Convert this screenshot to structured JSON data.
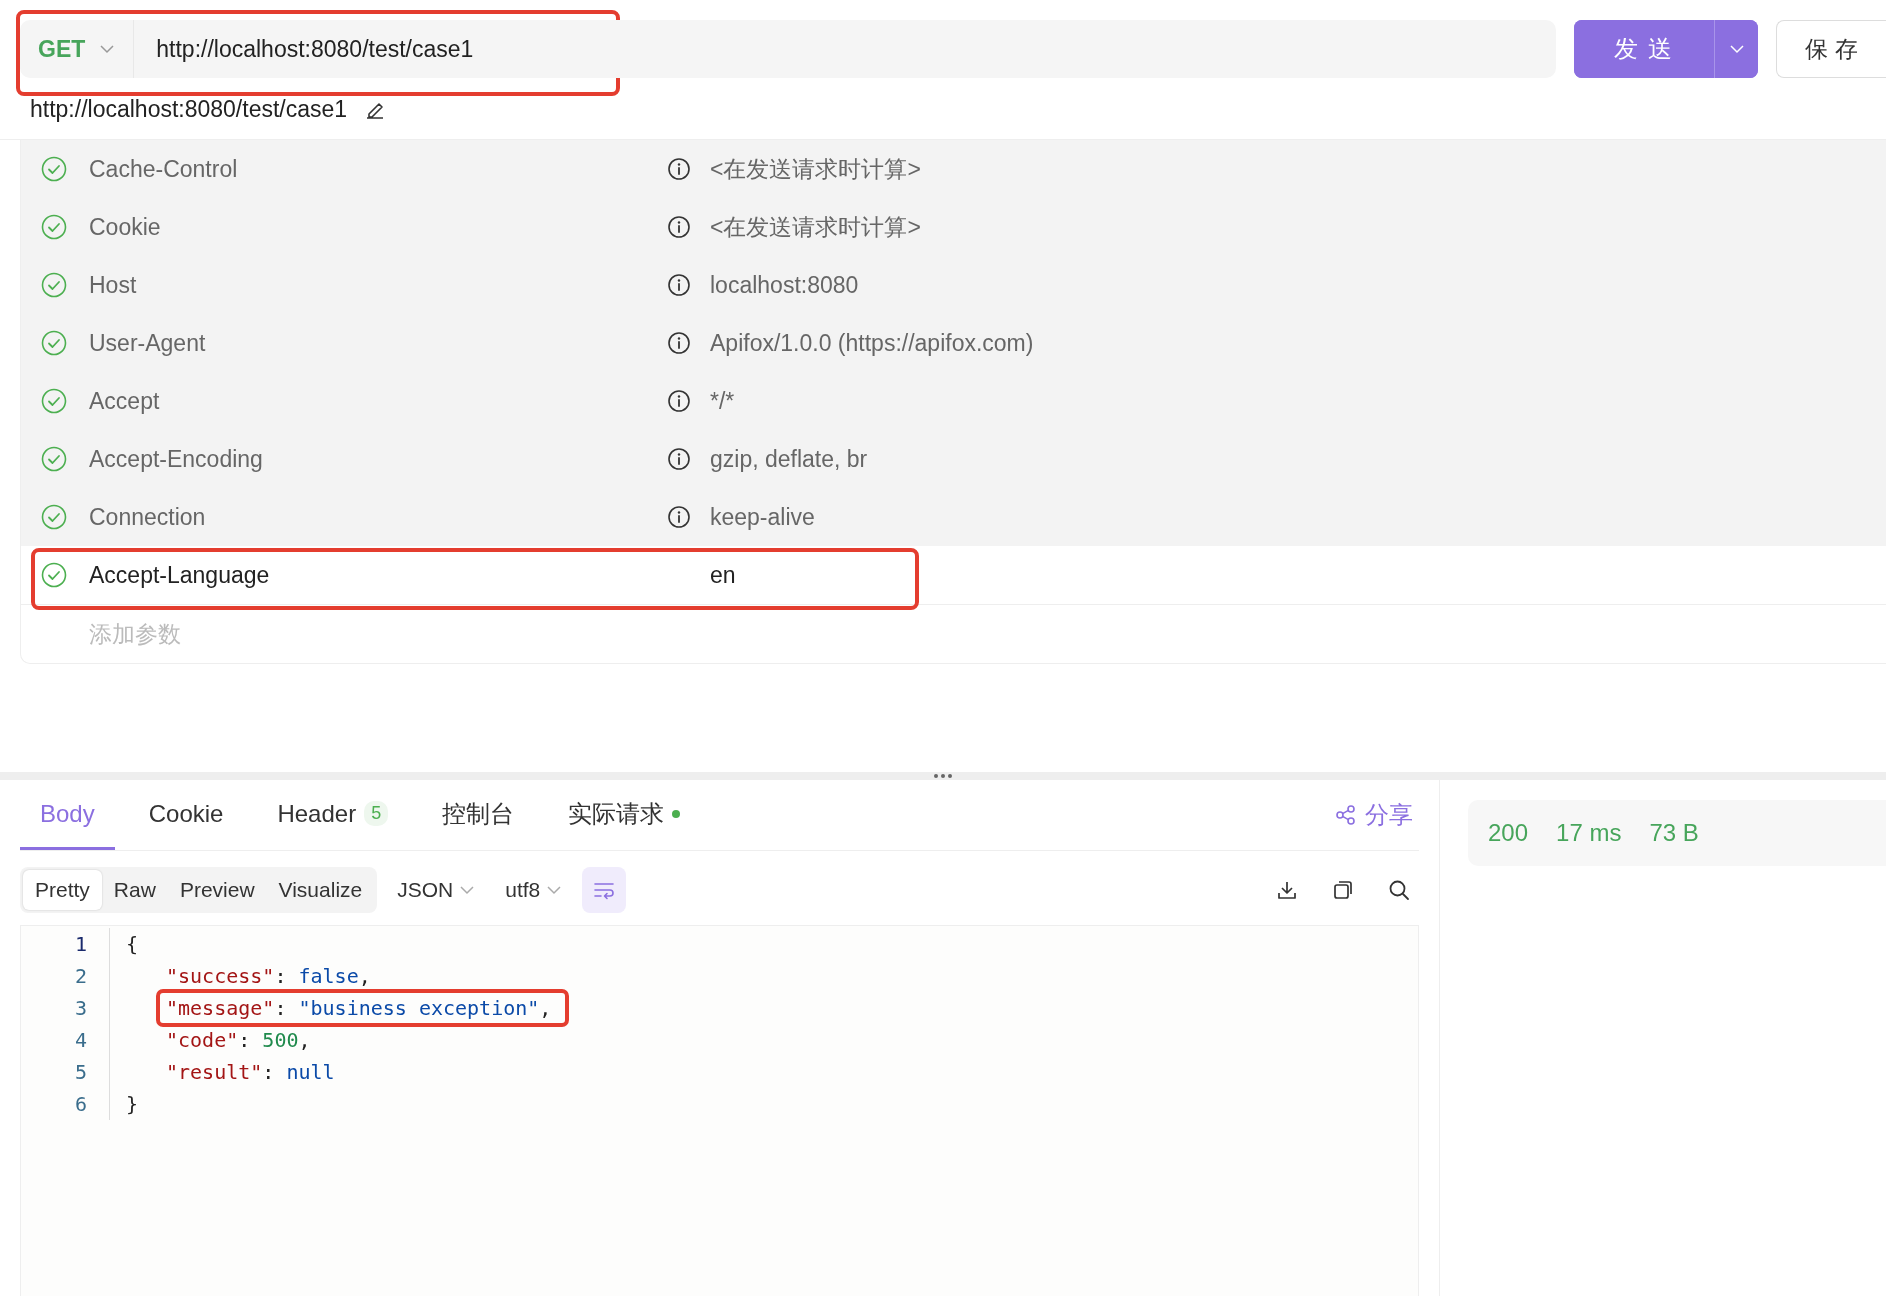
{
  "request": {
    "method": "GET",
    "url": "http://localhost:8080/test/case1",
    "highlighted": true,
    "send_label": "发 送",
    "save_label": "保 存",
    "path_title": "http://localhost:8080/test/case1"
  },
  "headers": [
    {
      "name": "Cache-Control",
      "value": "<在发送请求时计算>",
      "enabled": true,
      "auto": true,
      "highlighted": false
    },
    {
      "name": "Cookie",
      "value": "<在发送请求时计算>",
      "enabled": true,
      "auto": true,
      "highlighted": false
    },
    {
      "name": "Host",
      "value": "localhost:8080",
      "enabled": true,
      "auto": true,
      "highlighted": false
    },
    {
      "name": "User-Agent",
      "value": "Apifox/1.0.0 (https://apifox.com)",
      "enabled": true,
      "auto": true,
      "highlighted": false
    },
    {
      "name": "Accept",
      "value": "*/*",
      "enabled": true,
      "auto": true,
      "highlighted": false
    },
    {
      "name": "Accept-Encoding",
      "value": "gzip, deflate, br",
      "enabled": true,
      "auto": true,
      "highlighted": false
    },
    {
      "name": "Connection",
      "value": "keep-alive",
      "enabled": true,
      "auto": true,
      "highlighted": false
    },
    {
      "name": "Accept-Language",
      "value": "en",
      "enabled": true,
      "auto": false,
      "highlighted": true
    }
  ],
  "add_param_placeholder": "添加参数",
  "response": {
    "tabs": [
      {
        "label": "Body",
        "selected": true
      },
      {
        "label": "Cookie",
        "selected": false
      },
      {
        "label": "Header",
        "badge": "5",
        "selected": false
      },
      {
        "label": "控制台",
        "selected": false
      },
      {
        "label": "实际请求",
        "dot": true,
        "selected": false
      }
    ],
    "share_label": "分享",
    "views": [
      {
        "label": "Pretty",
        "selected": true
      },
      {
        "label": "Raw",
        "selected": false
      },
      {
        "label": "Preview",
        "selected": false
      },
      {
        "label": "Visualize",
        "selected": false
      }
    ],
    "format": "JSON",
    "encoding": "utf8",
    "wrap_on": true,
    "lines": [
      {
        "number": "1",
        "indent": false,
        "highlighted": false,
        "tokens": [
          {
            "kind": "punct",
            "text": "{"
          }
        ]
      },
      {
        "number": "2",
        "indent": true,
        "highlighted": false,
        "tokens": [
          {
            "kind": "key",
            "text": "\"success\""
          },
          {
            "kind": "punct",
            "text": ": "
          },
          {
            "kind": "literal",
            "text": "false"
          },
          {
            "kind": "punct",
            "text": ","
          }
        ]
      },
      {
        "number": "3",
        "indent": true,
        "highlighted": true,
        "tokens": [
          {
            "kind": "key",
            "text": "\"message\""
          },
          {
            "kind": "punct",
            "text": ": "
          },
          {
            "kind": "string",
            "text": "\"business exception\""
          },
          {
            "kind": "punct",
            "text": ","
          }
        ]
      },
      {
        "number": "4",
        "indent": true,
        "highlighted": false,
        "tokens": [
          {
            "kind": "key",
            "text": "\"code\""
          },
          {
            "kind": "punct",
            "text": ": "
          },
          {
            "kind": "number",
            "text": "500"
          },
          {
            "kind": "punct",
            "text": ","
          }
        ]
      },
      {
        "number": "5",
        "indent": true,
        "highlighted": false,
        "tokens": [
          {
            "kind": "key",
            "text": "\"result\""
          },
          {
            "kind": "punct",
            "text": ": "
          },
          {
            "kind": "literal",
            "text": "null"
          }
        ]
      },
      {
        "number": "6",
        "indent": false,
        "highlighted": false,
        "tokens": [
          {
            "kind": "punct",
            "text": "}"
          }
        ]
      }
    ],
    "status": {
      "code": "200",
      "time": "17 ms",
      "size": "73 B"
    }
  }
}
